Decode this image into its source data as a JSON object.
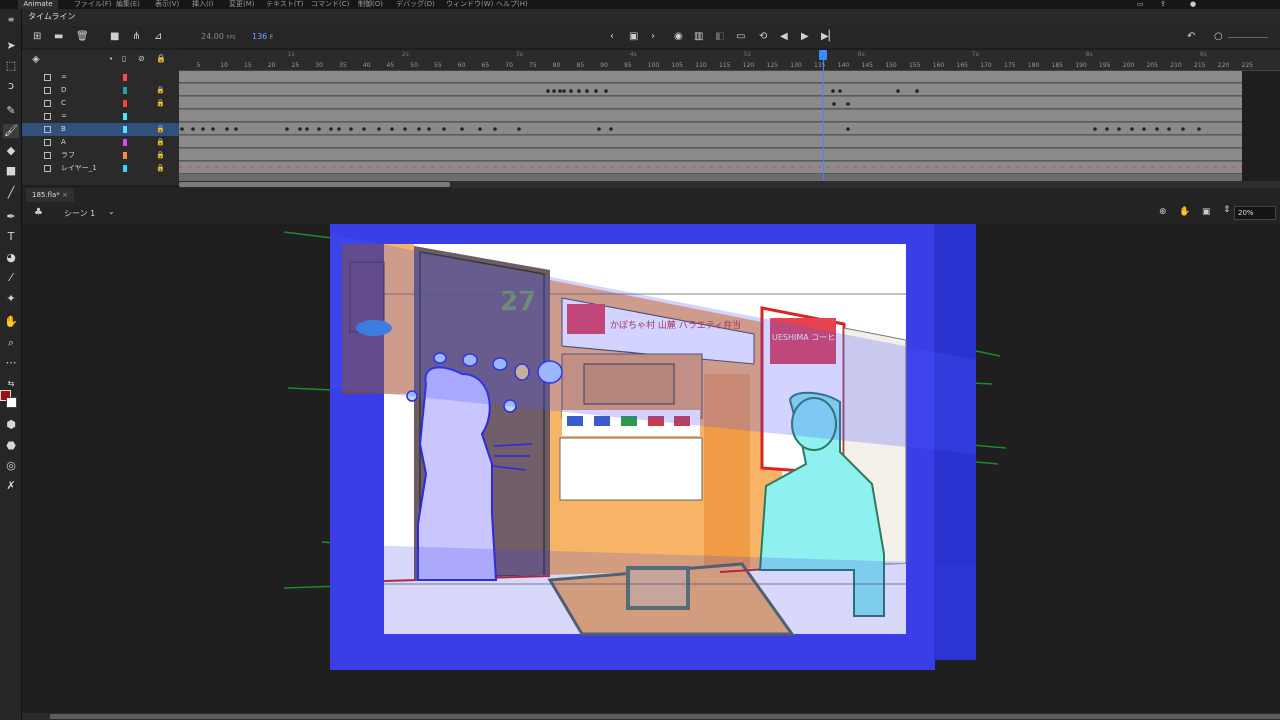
{
  "menubar": {
    "app_label": "Animate",
    "items": [
      "ファイル(F)",
      "編集(E)",
      "表示(V)",
      "挿入(I)",
      "変更(M)",
      "テキスト(T)",
      "コマンド(C)",
      "制御(O)",
      "デバッグ(D)",
      "ウィンドウ(W)",
      "ヘルプ(H)"
    ]
  },
  "timeline": {
    "panel_title": "タイムライン",
    "fps": "24.00",
    "fps_unit": "FPS",
    "current_frame": "136",
    "frame_unit": "F",
    "playhead_frame": 136,
    "ruler_ticks": [
      "5",
      "10",
      "15",
      "20",
      "25",
      "30",
      "35",
      "40",
      "45",
      "50",
      "55",
      "60",
      "65",
      "70",
      "75",
      "80",
      "85",
      "90",
      "95",
      "100",
      "105",
      "110",
      "115",
      "120",
      "125",
      "130",
      "135",
      "140",
      "145",
      "150",
      "155",
      "160",
      "165",
      "170",
      "175",
      "180",
      "185",
      "190",
      "195",
      "200",
      "205",
      "210",
      "215",
      "220",
      "225"
    ],
    "second_marks": [
      "1s",
      "2s",
      "3s",
      "4s",
      "5s",
      "6s",
      "7s",
      "8s",
      "9s"
    ],
    "layers": [
      {
        "name": "=",
        "color": "#ff4a4a",
        "locked": false,
        "selected": false
      },
      {
        "name": "D",
        "color": "#26a69a",
        "locked": true,
        "selected": false
      },
      {
        "name": "C",
        "color": "#ff3b3b",
        "locked": true,
        "selected": false
      },
      {
        "name": "=",
        "color": "#4fe3ff",
        "locked": false,
        "selected": false
      },
      {
        "name": "B",
        "color": "#4fe3ff",
        "locked": true,
        "selected": true
      },
      {
        "name": "A",
        "color": "#e040fb",
        "locked": true,
        "selected": false
      },
      {
        "name": "ラフ",
        "color": "#ff8a3d",
        "locked": true,
        "selected": false
      },
      {
        "name": "レイヤー_1",
        "color": "#33d6ff",
        "locked": true,
        "selected": false
      }
    ]
  },
  "document": {
    "tab_label": "185.fla*",
    "scene_label": "シーン 1",
    "zoom": "20%"
  },
  "stage": {
    "shop_sign": "UESHIMA コーヒー",
    "wall_sign": "かぼちゃ村 山麓 バラエティ弁当",
    "number_sign": "27"
  },
  "colors": {
    "accent": "#3b8bff",
    "stage_blue": "#3947e8",
    "stage_orange": "#f8b466",
    "stage_white": "#ffffff",
    "char_lilac": "#c9c5ff",
    "char_cyan": "#8ff0f0"
  }
}
